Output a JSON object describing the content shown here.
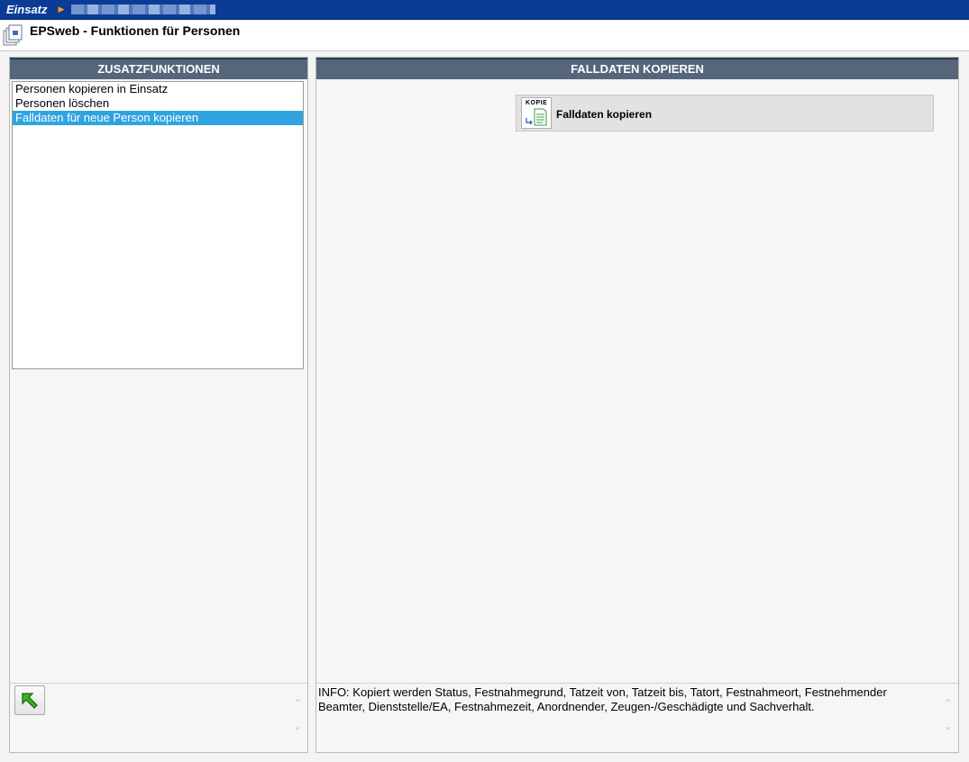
{
  "topbar": {
    "app_name": "Einsatz",
    "breadcrumb_separator": "▶"
  },
  "titlebar": {
    "title": "EPSweb - Funktionen für Personen"
  },
  "left_panel": {
    "header": "ZUSATZFUNKTIONEN",
    "items": [
      {
        "label": "Personen kopieren in Einsatz",
        "selected": false
      },
      {
        "label": "Personen löschen",
        "selected": false
      },
      {
        "label": "Falldaten für neue Person kopieren",
        "selected": true
      }
    ],
    "back_icon": "green-arrow-up-left-icon"
  },
  "right_panel": {
    "header": "FALLDATEN KOPIEREN",
    "action_button": {
      "icon_text": "KOPIE",
      "label": "Falldaten kopieren"
    },
    "info": "INFO: Kopiert werden Status, Festnahmegrund, Tatzeit von, Tatzeit bis, Tatort, Festnahmeort, Festnehmender Beamter, Dienststelle/EA, Festnahmezeit, Anordnender, Zeugen-/Geschädigte und Sachverhalt."
  },
  "scroll": {
    "up": "⌃",
    "down": "⌄"
  },
  "colors": {
    "topbar": "#0a3c96",
    "panel_header": "#55657a",
    "selection": "#2fa4e0"
  }
}
